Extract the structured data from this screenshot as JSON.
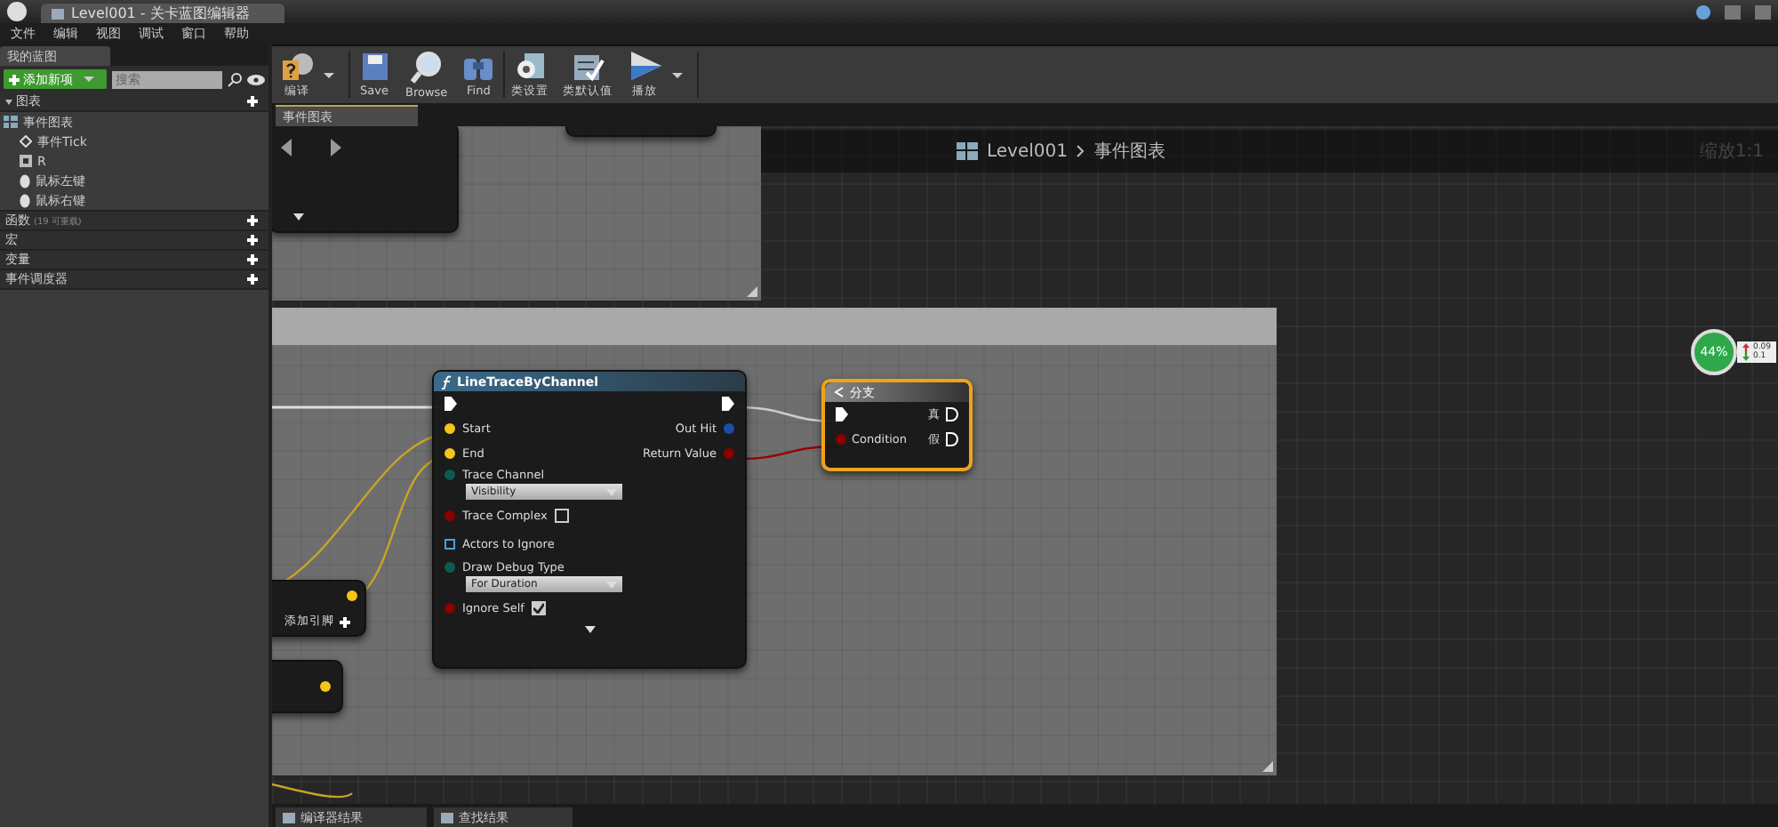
{
  "title_bar": {
    "tab": "Level001 - 关卡蓝图编辑器"
  },
  "menu": [
    "文件",
    "编辑",
    "视图",
    "调试",
    "窗口",
    "帮助"
  ],
  "my_blueprint": {
    "tab": "我的蓝图",
    "add_button": "添加新项",
    "search": {
      "placeholder": "搜索"
    },
    "sections": [
      {
        "label": "图表",
        "expanded": true,
        "children": [
          {
            "label": "事件图表",
            "children": [
              {
                "label": "事件Tick",
                "kind": "event"
              },
              {
                "label": "R",
                "kind": "key"
              },
              {
                "label": "鼠标左键",
                "kind": "mouse"
              },
              {
                "label": "鼠标右键",
                "kind": "mouse"
              }
            ]
          }
        ]
      },
      {
        "label": "函数",
        "note": "(19 可重载)",
        "expanded": false
      },
      {
        "label": "宏",
        "expanded": false
      },
      {
        "label": "变量",
        "expanded": false
      },
      {
        "label": "事件调度器",
        "expanded": false
      }
    ]
  },
  "toolbar": [
    {
      "label": "编译",
      "kind": "compile",
      "dropdown": true
    },
    {
      "label": "Save",
      "kind": "save",
      "dropdown": false
    },
    {
      "label": "Browse",
      "kind": "browse",
      "dropdown": false
    },
    {
      "label": "Find",
      "kind": "find",
      "dropdown": false
    },
    {
      "label": "类设置",
      "kind": "settings",
      "dropdown": false
    },
    {
      "label": "类默认值",
      "kind": "defaults",
      "dropdown": false
    },
    {
      "label": "播放",
      "kind": "play",
      "dropdown": true
    }
  ],
  "graph_tab": "事件图表",
  "breadcrumb": {
    "level": "Level001",
    "graph": "事件图表"
  },
  "zoom": "缩放1:1",
  "trace_node": {
    "title": "LineTraceByChannel",
    "inputs": [
      {
        "label": "Start",
        "kind": "vector"
      },
      {
        "label": "End",
        "kind": "vector"
      },
      {
        "label": "Trace Channel",
        "kind": "enum",
        "value": "Visibility"
      },
      {
        "label": "Trace Complex",
        "kind": "bool",
        "checked": false
      },
      {
        "label": "Actors to Ignore",
        "kind": "array"
      },
      {
        "label": "Draw Debug Type",
        "kind": "enum",
        "value": "For Duration"
      },
      {
        "label": "Ignore Self",
        "kind": "bool",
        "checked": true
      }
    ],
    "outputs": [
      {
        "label": "Out Hit",
        "kind": "struct"
      },
      {
        "label": "Return Value",
        "kind": "bool"
      }
    ]
  },
  "branch_node": {
    "title": "分支",
    "selected": true,
    "condition": "Condition",
    "outputs": [
      "真",
      "假"
    ]
  },
  "add_pin_node": {
    "label": "添加引脚"
  },
  "net_meter": {
    "percent": "44%",
    "up": "0.09",
    "down": "0.1"
  },
  "bottom_tabs": [
    "编译器结果",
    "查找结果"
  ]
}
